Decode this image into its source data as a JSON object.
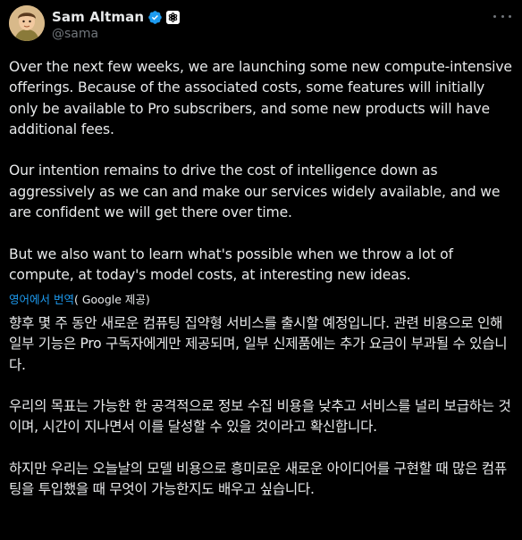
{
  "author": {
    "display_name": "Sam Altman",
    "handle": "@sama",
    "verified_icon": "verified-badge-icon",
    "affiliation_icon": "openai-logo-icon",
    "verified_color": "#1d9bf0"
  },
  "more_icon": "more-horizontal-icon",
  "tweet": {
    "paragraphs": [
      "Over the next few weeks, we are launching some new compute-intensive offerings. Because of the associated costs, some features will initially only be available to Pro subscribers, and some new products will have additional fees.",
      "Our intention remains to drive the cost of intelligence down as aggressively as we can and make our services widely available, and we are confident we will get there over time.",
      "But we also want to learn what's possible when we throw a lot of compute, at today's model costs, at interesting new ideas."
    ]
  },
  "translation_notice": {
    "link_text": "영어에서 번역",
    "provider_text": "( Google 제공)"
  },
  "translation": {
    "paragraphs": [
      "향후 몇 주 동안 새로운 컴퓨팅 집약형 서비스를 출시할 예정입니다. 관련 비용으로 인해 일부 기능은 Pro 구독자에게만 제공되며, 일부 신제품에는 추가 요금이 부과될 수 있습니다.",
      "우리의 목표는 가능한 한 공격적으로 정보 수집 비용을 낮추고 서비스를 널리 보급하는 것이며, 시간이 지나면서 이를 달성할 수 있을 것이라고 확신합니다.",
      "하지만 우리는 오늘날의 모델 비용으로 흥미로운 새로운 아이디어를 구현할 때 많은 컴퓨팅을 투입했을 때 무엇이 가능한지도 배우고 싶습니다."
    ]
  },
  "colors": {
    "background": "#000000",
    "text": "#e7e9ea",
    "secondary_text": "#71767b",
    "link": "#1d9bf0"
  }
}
